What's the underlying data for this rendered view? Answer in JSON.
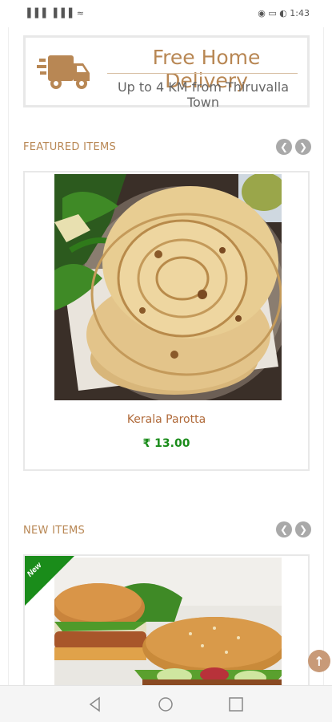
{
  "status_bar": {
    "signal_text": "▐▐▐ ▐▐▐ ≈",
    "right_text": "◉ ▭ ◐ 1:43",
    "time": "1:43"
  },
  "banner": {
    "title": "Free Home Delivery",
    "subtitle": "Up to 4 KM from Thiruvalla Town",
    "icon": "delivery-truck-icon",
    "accent_color": "#b88754"
  },
  "featured": {
    "title": "FEATURED ITEMS",
    "prev_label": "❮",
    "next_label": "❯",
    "items": [
      {
        "name": "Kerala Parotta",
        "price": "₹ 13.00"
      }
    ]
  },
  "new_items": {
    "title": "NEW ITEMS",
    "prev_label": "❮",
    "next_label": "❯",
    "ribbon": "New",
    "items": [
      {
        "name": "",
        "price": ""
      }
    ]
  },
  "scroll_top_label": "↑",
  "colors": {
    "price": "#1a8c1a",
    "product_name": "#b06a3a",
    "ribbon": "#1a8c1a",
    "arrow_bg": "#a9a9a9"
  }
}
